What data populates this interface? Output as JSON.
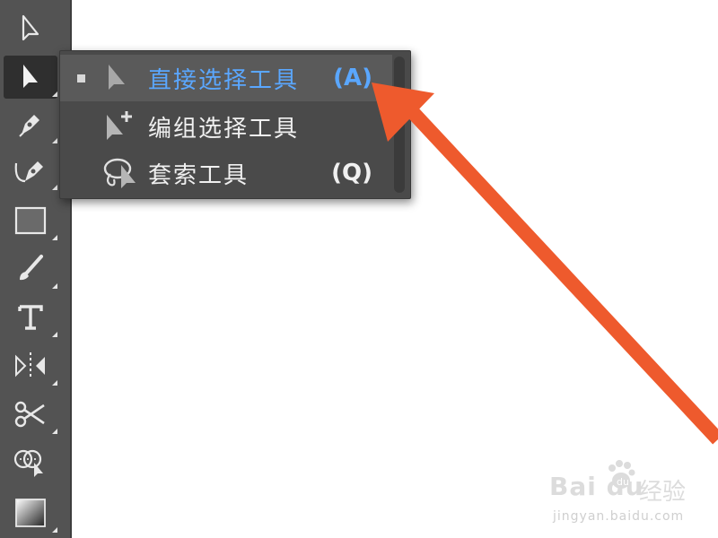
{
  "flyout": {
    "items": [
      {
        "label": "直接选择工具",
        "shortcut": "(A)",
        "selected": true
      },
      {
        "label": "编组选择工具",
        "shortcut": "",
        "selected": false
      },
      {
        "label": "套索工具",
        "shortcut": "(Q)",
        "selected": false
      }
    ]
  },
  "tools": [
    {
      "icon": "selection-arrow-icon"
    },
    {
      "icon": "direct-selection-arrow-icon"
    },
    {
      "icon": "pen-icon"
    },
    {
      "icon": "curvature-pen-icon"
    },
    {
      "icon": "rectangle-icon"
    },
    {
      "icon": "paintbrush-icon"
    },
    {
      "icon": "type-icon"
    },
    {
      "icon": "reflect-icon"
    },
    {
      "icon": "scissors-icon"
    },
    {
      "icon": "shape-builder-icon"
    },
    {
      "icon": "gradient-icon"
    }
  ],
  "colors": {
    "highlight": "#5aa7ff",
    "arrow": "#ee5a2d",
    "toolbar": "#535353",
    "menu": "#4a4a4a"
  },
  "watermark": {
    "logo": "Bai du",
    "cn": "经验",
    "url": "jingyan.baidu.com"
  }
}
